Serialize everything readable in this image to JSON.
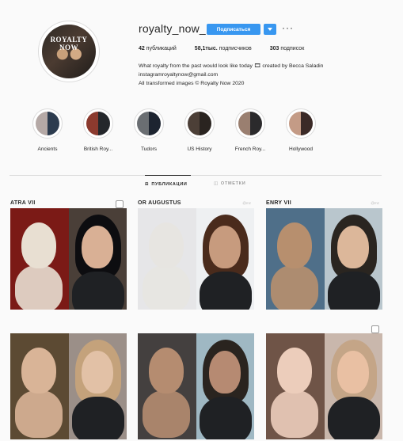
{
  "profile": {
    "avatar_text": "ROYALTY\nNOW",
    "username": "royalty_now_",
    "follow_label": "Подписаться",
    "stats": [
      {
        "value": "42",
        "label": "публикаций"
      },
      {
        "value": "58,1тыс.",
        "label": "подписчиков"
      },
      {
        "value": "303",
        "label": "подписок"
      }
    ],
    "bio_lines": [
      "What royalty from the past would look like today 🎞 created by Becca Saladin",
      "instagramroyaltynow@gmail.com",
      "All transformed images © Royalty Now 2020"
    ]
  },
  "highlights": [
    {
      "label": "Ancients",
      "colors": [
        "#b5a9a6",
        "#2c3b4e"
      ]
    },
    {
      "label": "British Roy...",
      "colors": [
        "#8b3a2e",
        "#24272b"
      ]
    },
    {
      "label": "Tudors",
      "colors": [
        "#6a6e72",
        "#1d2430"
      ]
    },
    {
      "label": "US History",
      "colors": [
        "#4c3f37",
        "#2a2420"
      ]
    },
    {
      "label": "French Roy...",
      "colors": [
        "#9a7f70",
        "#2b2a2c"
      ]
    },
    {
      "label": "Hollywood",
      "colors": [
        "#c49b86",
        "#3b2a27"
      ]
    }
  ],
  "tabs": [
    {
      "label": "ПУБЛИКАЦИИ",
      "icon": "grid-icon",
      "active": true
    },
    {
      "label": "ОТМЕТКИ",
      "icon": "tag-icon",
      "active": false
    }
  ],
  "posts": [
    {
      "caption": "ATRA VII",
      "left_bg": "#7b1a16",
      "right_bg": "#4a3f38",
      "left_face": "#e8dfd2",
      "right_face": "#d9b095",
      "hair": "#0d0d10",
      "multi": true
    },
    {
      "caption": "OR AUGUSTUS",
      "left_bg": "#e6e6e8",
      "right_bg": "#eef0f2",
      "left_face": "#e7e5e1",
      "right_face": "#c79b7e",
      "hair": "#4a2b1c",
      "multi": false,
      "gmz": "@mz"
    },
    {
      "caption": "ENRY VII",
      "left_bg": "#4f6f89",
      "right_bg": "#b9c6cd",
      "left_face": "#b78f6e",
      "right_face": "#dcb79a",
      "hair": "#2a2520",
      "multi": false,
      "gmz": "@mz"
    },
    {
      "caption": "",
      "left_bg": "#5c4a33",
      "right_bg": "#9b8f88",
      "left_face": "#d9b497",
      "right_face": "#e2c1a6",
      "hair": "#c4a27b",
      "multi": false
    },
    {
      "caption": "",
      "left_bg": "#44403f",
      "right_bg": "#9fb8c3",
      "left_face": "#b58c70",
      "right_face": "#b68a72",
      "hair": "#2a241f",
      "multi": false
    },
    {
      "caption": "",
      "left_bg": "#6f5447",
      "right_bg": "#c9b7ac",
      "left_face": "#eccdbb",
      "right_face": "#e9c0a3",
      "hair": "#c4a587",
      "multi": true
    }
  ]
}
